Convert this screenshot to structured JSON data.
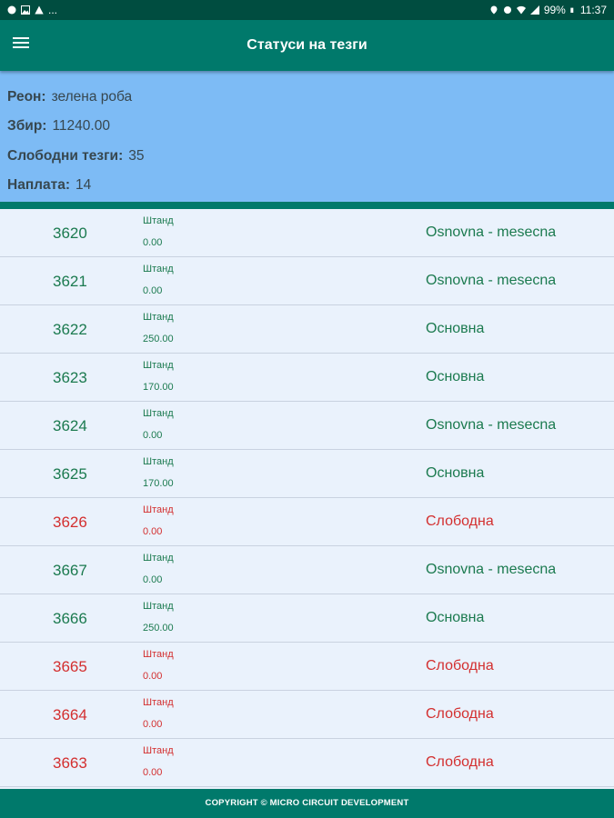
{
  "statusbar": {
    "battery": "99%",
    "time": "11:37",
    "more": "..."
  },
  "appbar": {
    "title": "Статуси на тезги"
  },
  "summary": {
    "region_label": "Реон:",
    "region_value": "зелена роба",
    "sum_label": "Збир:",
    "sum_value": "11240.00",
    "free_label": "Слободни тезги:",
    "free_value": "35",
    "paid_label": "Наплата:",
    "paid_value": "14"
  },
  "colors": {
    "green": "#1b7a4f",
    "red": "#d32f2f",
    "appbar": "#00796b",
    "summary_bg": "#7dbbf5"
  },
  "stalls": [
    {
      "number": "3620",
      "label": "Штанд",
      "amount": "0.00",
      "status": "Osnovna - mesecna",
      "state": "g"
    },
    {
      "number": "3621",
      "label": "Штанд",
      "amount": "0.00",
      "status": "Osnovna - mesecna",
      "state": "g"
    },
    {
      "number": "3622",
      "label": "Штанд",
      "amount": "250.00",
      "status": "Основна",
      "state": "g"
    },
    {
      "number": "3623",
      "label": "Штанд",
      "amount": "170.00",
      "status": "Основна",
      "state": "g"
    },
    {
      "number": "3624",
      "label": "Штанд",
      "amount": "0.00",
      "status": "Osnovna - mesecna",
      "state": "g"
    },
    {
      "number": "3625",
      "label": "Штанд",
      "amount": "170.00",
      "status": "Основна",
      "state": "g"
    },
    {
      "number": "3626",
      "label": "Штанд",
      "amount": "0.00",
      "status": "Слободна",
      "state": "r"
    },
    {
      "number": "3667",
      "label": "Штанд",
      "amount": "0.00",
      "status": "Osnovna - mesecna",
      "state": "g"
    },
    {
      "number": "3666",
      "label": "Штанд",
      "amount": "250.00",
      "status": "Основна",
      "state": "g"
    },
    {
      "number": "3665",
      "label": "Штанд",
      "amount": "0.00",
      "status": "Слободна",
      "state": "r"
    },
    {
      "number": "3664",
      "label": "Штанд",
      "amount": "0.00",
      "status": "Слободна",
      "state": "r"
    },
    {
      "number": "3663",
      "label": "Штанд",
      "amount": "0.00",
      "status": "Слободна",
      "state": "r"
    }
  ],
  "footer": {
    "copyright": "COPYRIGHT © MICRO CIRCUIT DEVELOPMENT"
  }
}
